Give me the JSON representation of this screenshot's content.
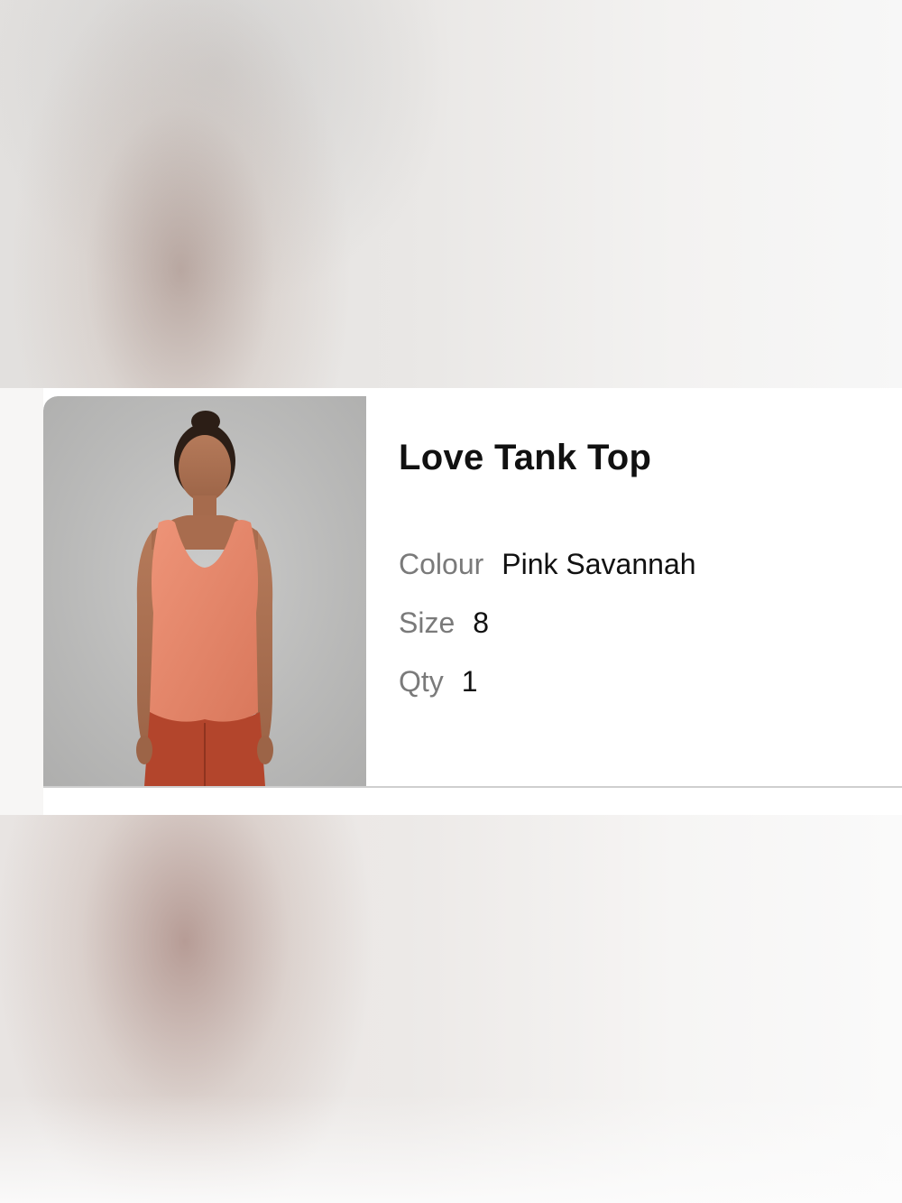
{
  "product": {
    "title": "Love Tank Top",
    "image_alt": "model wearing tank top",
    "attributes": {
      "colour_label": "Colour",
      "colour_value": "Pink Savannah",
      "size_label": "Size",
      "size_value": "8",
      "qty_label": "Qty",
      "qty_value": "1"
    }
  },
  "colors": {
    "tank": "#e8876a",
    "pants": "#b3452c",
    "photo_background": "#bdbdbc",
    "label_gray": "#7a7a7a",
    "text_dark": "#111111"
  }
}
